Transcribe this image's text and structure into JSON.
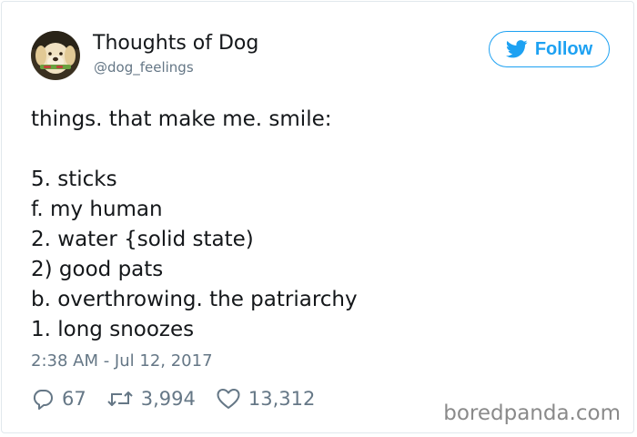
{
  "user": {
    "display_name": "Thoughts of Dog",
    "handle": "@dog_feelings",
    "avatar_icon": "dog-avatar"
  },
  "follow_button": {
    "label": "Follow",
    "icon": "twitter-bird-icon",
    "color": "#1da1f2"
  },
  "tweet": {
    "lines": [
      "things. that make me. smile:",
      "",
      "5. sticks",
      "f. my human",
      "2. water {solid state)",
      "2) good pats",
      "b. overthrowing. the patriarchy",
      "1. long snoozes"
    ]
  },
  "timestamp": "2:38 AM - Jul 12, 2017",
  "actions": {
    "replies": {
      "icon": "reply-icon",
      "count": "67"
    },
    "retweets": {
      "icon": "retweet-icon",
      "count": "3,994"
    },
    "likes": {
      "icon": "heart-icon",
      "count": "13,312"
    }
  },
  "watermark": "boredpanda.com",
  "colors": {
    "text": "#14171a",
    "muted": "#657786",
    "brand": "#1da1f2"
  }
}
